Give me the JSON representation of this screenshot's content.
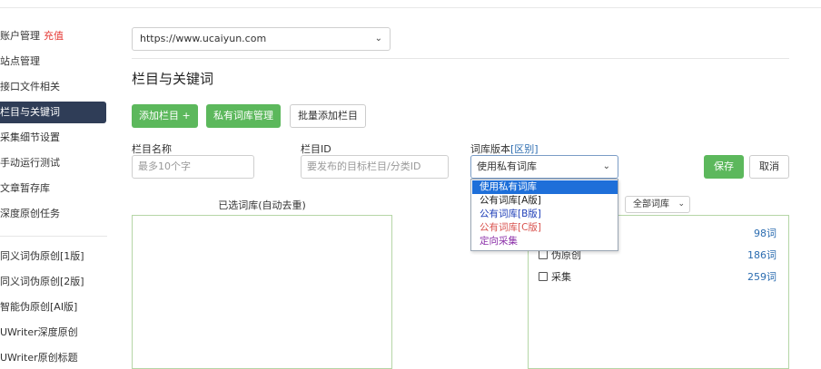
{
  "sidebar": {
    "items": [
      {
        "label": "账户管理",
        "accent": "充值"
      },
      {
        "label": "站点管理"
      },
      {
        "label": "接口文件相关"
      },
      {
        "label": "栏目与关键词",
        "active": true
      },
      {
        "label": "采集细节设置"
      },
      {
        "label": "手动运行测试"
      },
      {
        "label": "文章暂存库"
      },
      {
        "label": "深度原创任务"
      },
      {
        "label": "同义词伪原创[1版]"
      },
      {
        "label": "同义词伪原创[2版]"
      },
      {
        "label": "智能伪原创[AI版]"
      },
      {
        "label": "UWriter深度原创"
      },
      {
        "label": "UWriter原创标题"
      }
    ]
  },
  "site_select": {
    "value": "https://www.ucaiyun.com"
  },
  "page_title": "栏目与关键词",
  "toolbar": {
    "add_column": "添加栏目 +",
    "private_lib": "私有词库管理",
    "batch_add": "批量添加栏目"
  },
  "form": {
    "column_name_label": "栏目名称",
    "column_name_placeholder": "最多10个字",
    "column_id_label": "栏目ID",
    "column_id_placeholder": "要发布的目标栏目/分类ID",
    "lib_version_label": "词库版本",
    "lib_version_link": "[区别]",
    "lib_version_value": "使用私有词库",
    "save": "保存",
    "cancel": "取消"
  },
  "dropdown": {
    "options": [
      {
        "label": "使用私有词库",
        "highlighted": true
      },
      {
        "label": "公有词库[A版]"
      },
      {
        "label": "公有词库[B版]",
        "color": "blue"
      },
      {
        "label": "公有词库[C版]",
        "color": "red"
      },
      {
        "label": "定向采集",
        "color": "purple"
      }
    ]
  },
  "left_panel": {
    "caption": "已选词库(自动去重)"
  },
  "right_panel": {
    "filter": "全部词库",
    "libraries": [
      {
        "name": "",
        "count": "98词"
      },
      {
        "name": "伪原创",
        "count": "186词"
      },
      {
        "name": "采集",
        "count": "259词"
      }
    ]
  },
  "colors": {
    "accent_green": "#5cb85c",
    "sidebar_active": "#2f3d57",
    "link_blue": "#2b6cb0",
    "accent_red": "#e53935",
    "dropdown_highlight": "#1e6fd9"
  }
}
